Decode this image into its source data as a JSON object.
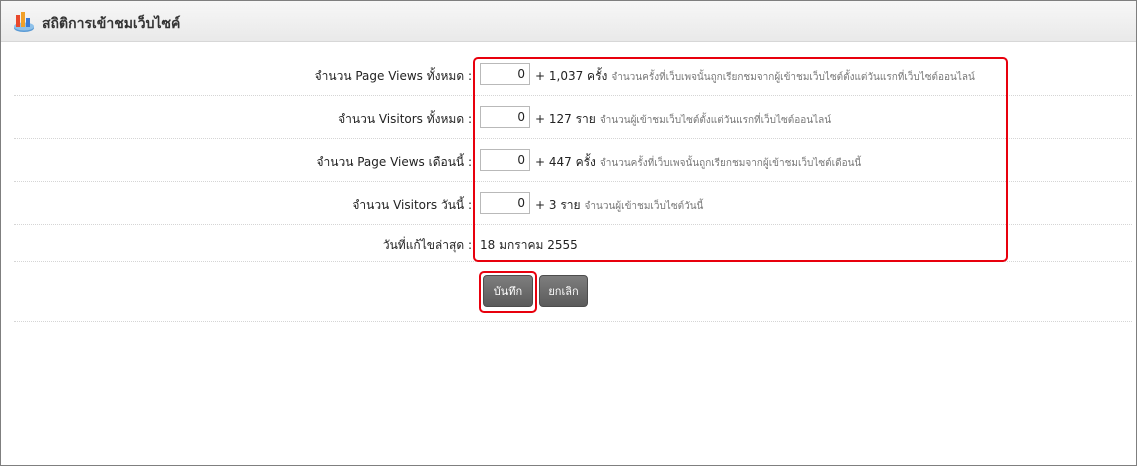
{
  "header": {
    "title": "สถิติการเข้าชมเว็บไซค์",
    "icon": "stats-chart-icon"
  },
  "rows": [
    {
      "label": "จำนวน Page Views ทั้งหมด :",
      "input_value": "0",
      "total": "+ 1,037 ครั้ง",
      "hint": "จำนวนครั้งที่เว็บเพจนั้นถูกเรียกชมจากผู้เข้าชมเว็บไซต์ตั้งแต่วันแรกที่เว็บไซต์ออนไลน์"
    },
    {
      "label": "จำนวน Visitors ทั้งหมด :",
      "input_value": "0",
      "total": "+ 127 ราย",
      "hint": "จำนวนผู้เข้าชมเว็บไซต์ตั้งแต่วันแรกที่เว็บไซต์ออนไลน์"
    },
    {
      "label": "จำนวน Page Views เดือนนี้ :",
      "input_value": "0",
      "total": "+ 447 ครั้ง",
      "hint": "จำนวนครั้งที่เว็บเพจนั้นถูกเรียกชมจากผู้เข้าชมเว็บไซต์เดือนนี้"
    },
    {
      "label": "จำนวน Visitors วันนี้ :",
      "input_value": "0",
      "total": "+ 3 ราย",
      "hint": "จำนวนผู้เข้าชมเว็บไซต์วันนี้"
    }
  ],
  "last_updated": {
    "label": "วันที่แก้ไขล่าสุด :",
    "value": "18 มกราคม 2555"
  },
  "buttons": {
    "save_label": "บันทึก",
    "cancel_label": "ยกเลิก"
  },
  "colors": {
    "highlight": "#e8000d",
    "button": "#6b6b6b"
  }
}
